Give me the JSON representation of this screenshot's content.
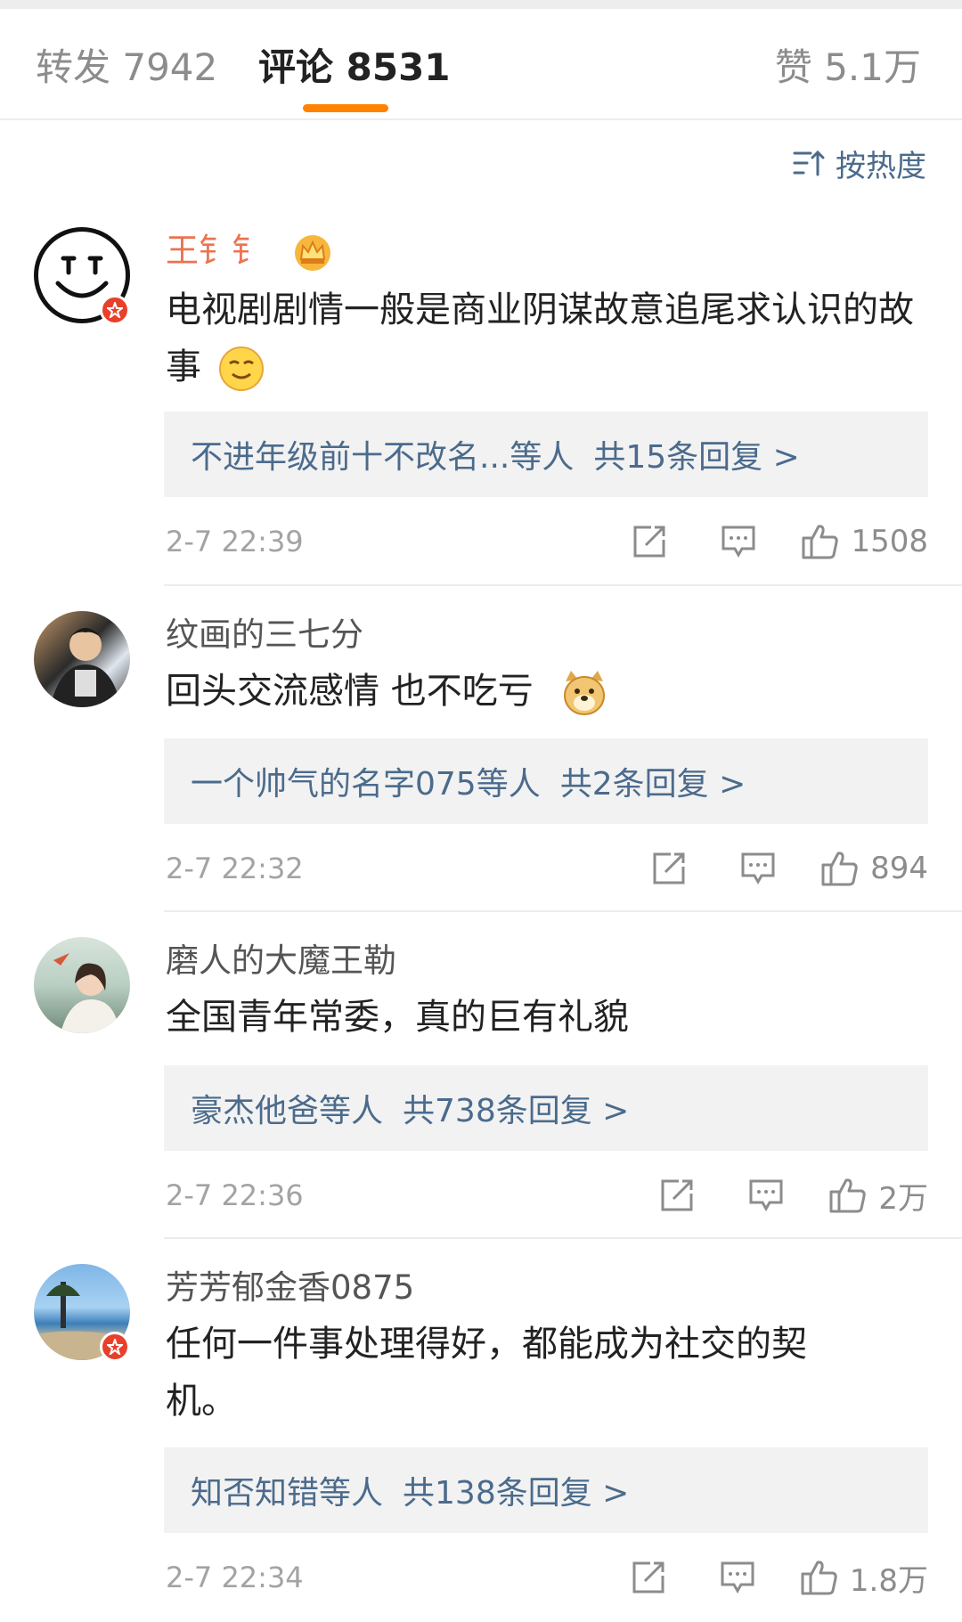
{
  "tabs": {
    "repost": "转发 7942",
    "comment": "评论 8531",
    "like": "赞 5.1万"
  },
  "sort_label": "按热度",
  "accent_color": "#ff8200",
  "link_color": "#4b6b8c",
  "comments": [
    {
      "user": "王钅钅",
      "content": "电视剧剧情一般是商业阴谋故意追尾求认识的故事",
      "emoji": "smirk-emoji",
      "reply_users": "不进年级前十不改名...等人",
      "reply_total": "共15条回复 >",
      "time": "2-7 22:39",
      "likes": "1508"
    },
    {
      "user": "纹画的三七分",
      "content": "回头交流感情 也不吃亏",
      "emoji": "doge-emoji",
      "reply_users": "一个帅气的名字075等人",
      "reply_total": "共2条回复 >",
      "time": "2-7 22:32",
      "likes": "894"
    },
    {
      "user": "磨人的大魔王勒",
      "content": "全国青年常委，真的巨有礼貌",
      "reply_users": "豪杰他爸等人",
      "reply_total": "共738条回复 >",
      "time": "2-7 22:36",
      "likes": "2万"
    },
    {
      "user": "芳芳郁金香0875",
      "content": "任何一件事处理得好，都能成为社交的契机。",
      "reply_users": "知否知错等人",
      "reply_total": "共138条回复 >",
      "time": "2-7 22:34",
      "likes": "1.8万"
    }
  ]
}
